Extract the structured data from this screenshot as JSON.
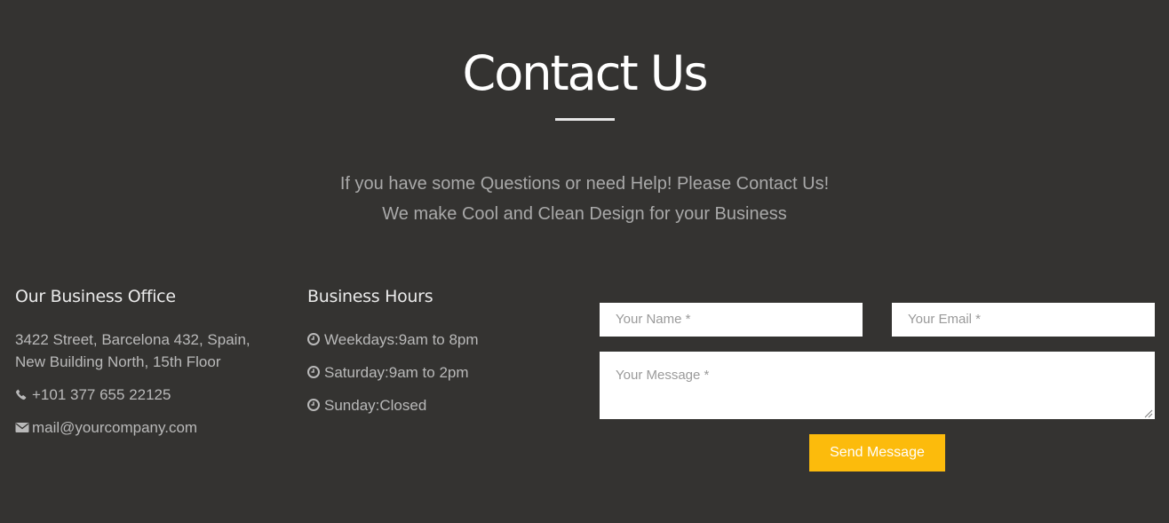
{
  "header": {
    "title": "Contact Us",
    "intro_line1": "If you have some Questions or need Help! Please Contact Us!",
    "intro_line2": "We make Cool and Clean Design for your Business"
  },
  "office": {
    "heading": "Our Business Office",
    "address_line1": "3422 Street, Barcelona 432, Spain,",
    "address_line2": "New Building North, 15th Floor",
    "phone": "+101 377 655 22125",
    "email": "mail@yourcompany.com",
    "phone_icon": "phone-icon",
    "email_icon": "envelope-icon"
  },
  "hours": {
    "heading": "Business Hours",
    "icon": "clock-icon",
    "items": [
      "Weekdays:9am to 8pm",
      "Saturday:9am to 2pm",
      "Sunday:Closed"
    ]
  },
  "form": {
    "name_placeholder": "Your Name *",
    "email_placeholder": "Your Email *",
    "message_placeholder": "Your Message *",
    "submit_label": "Send Message"
  },
  "colors": {
    "background": "#343331",
    "accent": "#fcbb0c",
    "text_light": "#ffffff",
    "text_muted": "#b9b9b9"
  }
}
